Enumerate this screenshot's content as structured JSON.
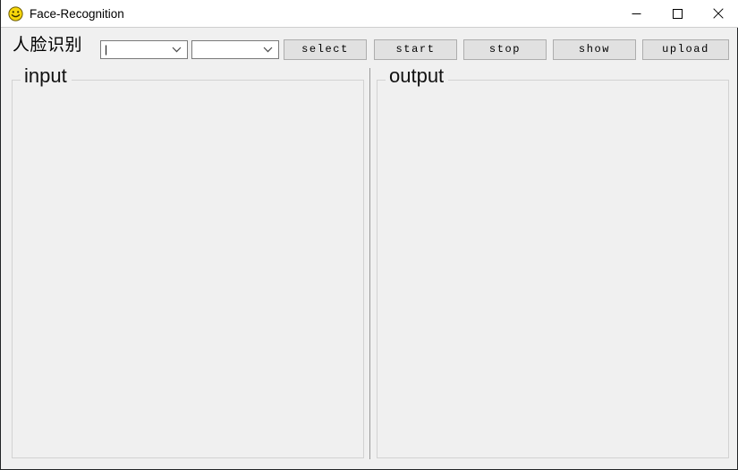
{
  "window": {
    "title": "Face-Recognition",
    "icon": "smiley-face-icon",
    "minimize_label": "Minimize",
    "maximize_label": "Maximize",
    "close_label": "Close",
    "background_color": "#f0f0f0",
    "titlebar_color": "#ffffff"
  },
  "toolbar": {
    "app_label": "人脸识别",
    "combos": [
      {
        "name": "camera-select",
        "value": "",
        "placeholder": "",
        "editable": true,
        "has_caret": true
      },
      {
        "name": "model-select",
        "value": "",
        "placeholder": "",
        "editable": false,
        "has_caret": false
      }
    ],
    "buttons": [
      {
        "name": "select",
        "label": "select"
      },
      {
        "name": "start",
        "label": "start"
      },
      {
        "name": "stop",
        "label": "stop"
      },
      {
        "name": "show",
        "label": "show"
      },
      {
        "name": "upload",
        "label": "upload"
      }
    ],
    "button_face_color": "#e1e1e1",
    "button_border_color": "#adadad"
  },
  "panels": {
    "input": {
      "title": "input",
      "content": ""
    },
    "output": {
      "title": "output",
      "content": ""
    }
  },
  "colors": {
    "accent": "#ffd400",
    "border": "#d2d2d2",
    "splitter": "#9a9a9a",
    "text": "#000000"
  }
}
